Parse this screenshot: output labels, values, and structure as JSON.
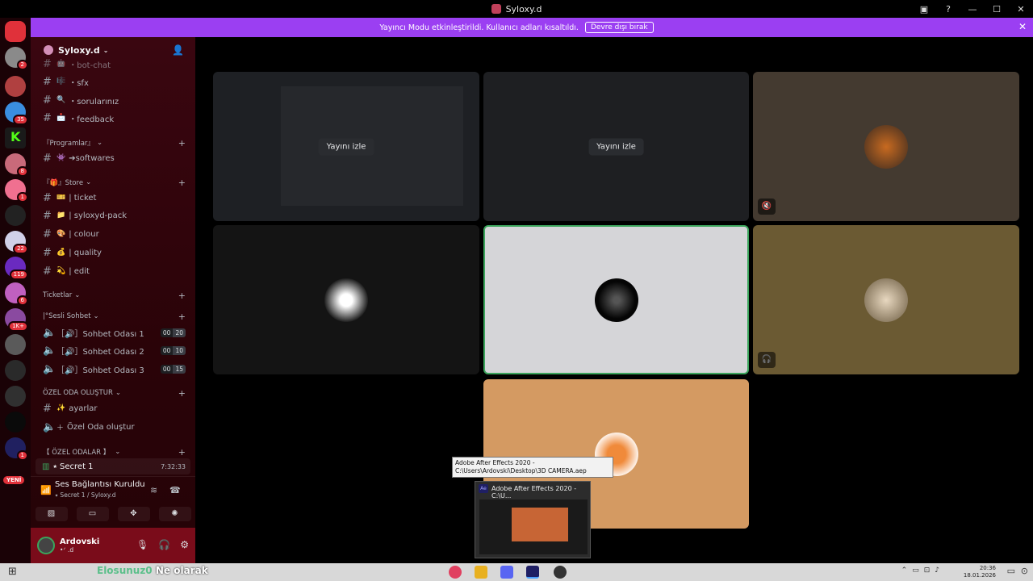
{
  "window": {
    "title": "Syloxy.d"
  },
  "notice": {
    "text": "Yayıncı Modu etkinleştirildi. Kullanıcı adları kısaltıldı.",
    "button": "Devre dışı bırak",
    "close": "✕"
  },
  "servers": {
    "badges": [
      "2",
      "35",
      "8",
      "1",
      "22",
      "119",
      "6",
      "1K+",
      "1",
      "1"
    ],
    "new_label": "YENİ"
  },
  "guild": {
    "name": "Syloxy.d"
  },
  "channels": [
    {
      "emoji": "🤖",
      "name": "・bot-chat"
    },
    {
      "emoji": "🎼",
      "name": "・sfx"
    },
    {
      "emoji": "🔍",
      "name": "・sorularınız"
    },
    {
      "emoji": "📩",
      "name": "・feedback"
    }
  ],
  "categories": {
    "programlar": "『Programlar』",
    "store": "『🎁』Store",
    "ticketlar": "Ticketlar",
    "sesli": "|°Sesli Sohbet",
    "ozel_olustur": "ÖZEL ODA OLUŞTUR",
    "ozel_odalar": "【 ÖZEL ODALAR 】"
  },
  "programlar_channels": [
    {
      "emoji": "👾",
      "name": "➔softwares"
    }
  ],
  "store_channels": [
    {
      "emoji": "🎫",
      "name": "| ticket"
    },
    {
      "emoji": "📁",
      "name": "| syloxyd-pack"
    },
    {
      "emoji": "🎨",
      "name": "| colour"
    },
    {
      "emoji": "💰",
      "name": "| quality"
    },
    {
      "emoji": "💫",
      "name": "| edit"
    }
  ],
  "voice_channels": [
    {
      "name": "［🔊］Sohbet Odası 1",
      "current": "00",
      "max": "20"
    },
    {
      "name": "［🔊］Sohbet Odası 2",
      "current": "00",
      "max": "10"
    },
    {
      "name": "［🔊］Sohbet Odası 3",
      "current": "00",
      "max": "15"
    }
  ],
  "ozel_channels": {
    "ayarlar": "ayarlar",
    "ayarlar_emoji": "✨",
    "olustur": "Özel Oda oluştur"
  },
  "secret": {
    "name": "⭑ Secret 1",
    "time": "7:32:33"
  },
  "voice_status": {
    "title": "Ses Bağlantısı Kuruldu",
    "subtitle": "⭑ Secret 1 / Syloxy.d"
  },
  "user": {
    "name": "Ardovski",
    "status": "•ᐟ .d"
  },
  "stage": {
    "watch_label": "Yayını izle"
  },
  "tooltip": {
    "text": "Adobe After Effects 2020 - C:\\Users\\Ardovski\\Desktop\\3D CAMERA.aep"
  },
  "preview": {
    "title": "Adobe After Effects 2020 - C:\\U...",
    "badge": "Ae"
  },
  "taskbar": {
    "text_a": "Elosunuz0",
    "text_b": "Ne olarak",
    "time": "20:36",
    "date": "18.01.2026"
  },
  "colors": {
    "accent": "#9b3ff2",
    "sidebar": "#2a0308",
    "userbar": "#7a0c1a",
    "speaking": "#3ba55c"
  }
}
